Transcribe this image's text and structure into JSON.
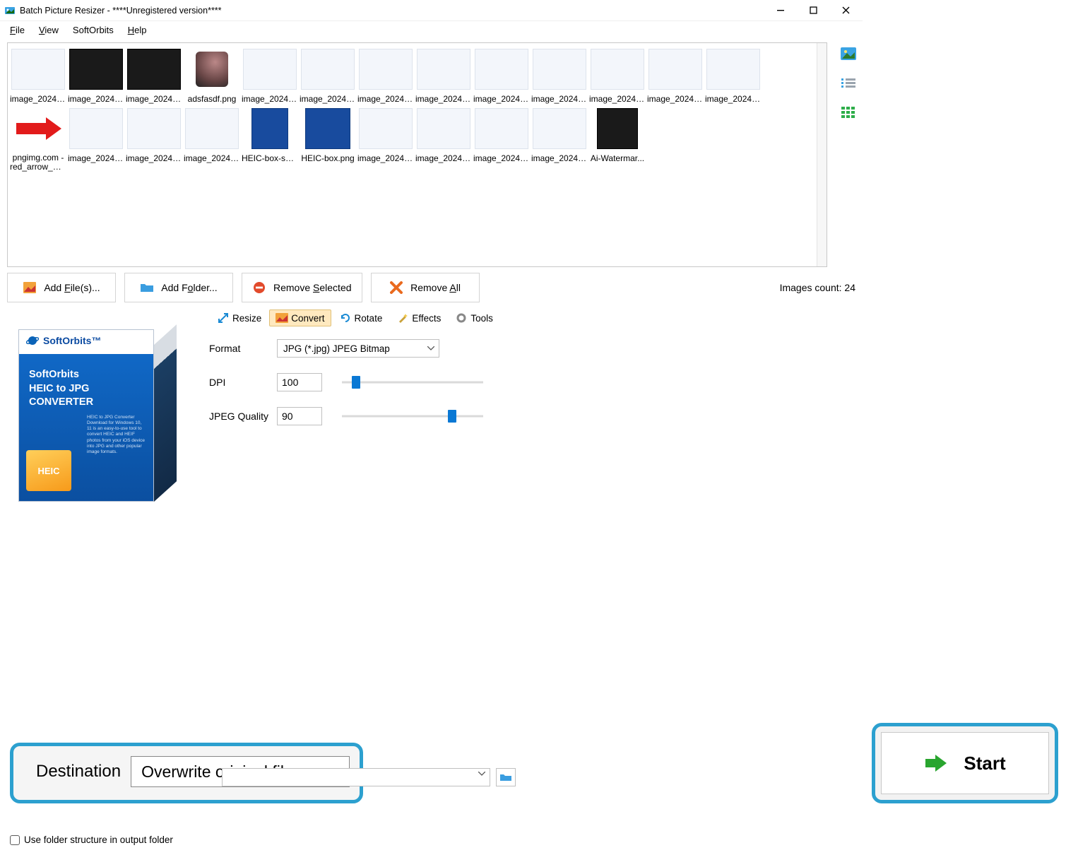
{
  "window": {
    "title": "Batch Picture Resizer - ****Unregistered version****"
  },
  "menu": {
    "file": "File",
    "view": "View",
    "softorbits": "SoftOrbits",
    "help": "Help"
  },
  "thumbnails": [
    {
      "label": "image_2024-..."
    },
    {
      "label": "image_2024-..."
    },
    {
      "label": "image_2024-..."
    },
    {
      "label": "adsfasdf.png"
    },
    {
      "label": "image_2024-..."
    },
    {
      "label": "image_2024-..."
    },
    {
      "label": "image_2024-..."
    },
    {
      "label": "image_2024-..."
    },
    {
      "label": "image_2024-..."
    },
    {
      "label": "image_2024-..."
    },
    {
      "label": "image_2024-..."
    },
    {
      "label": "image_2024-..."
    },
    {
      "label": "image_2024-..."
    },
    {
      "label": "pngimg.com - red_arrow_PN..."
    },
    {
      "label": "image_2024-..."
    },
    {
      "label": "image_2024-..."
    },
    {
      "label": "image_2024-..."
    },
    {
      "label": "HEIC-box-sm..."
    },
    {
      "label": "HEIC-box.png"
    },
    {
      "label": "image_2024-..."
    },
    {
      "label": "image_2024-..."
    },
    {
      "label": "image_2024-..."
    },
    {
      "label": "image_2024-..."
    },
    {
      "label": "Ai-Watermar..."
    }
  ],
  "actions": {
    "add_files": "Add File(s)...",
    "add_folder": "Add Folder...",
    "remove_selected": "Remove Selected",
    "remove_all": "Remove All"
  },
  "images_count_label": "Images count: 24",
  "tabs": {
    "resize": "Resize",
    "convert": "Convert",
    "rotate": "Rotate",
    "effects": "Effects",
    "tools": "Tools"
  },
  "promo": {
    "brand": "SoftOrbits™",
    "title1": "SoftOrbits",
    "title2": "HEIC to JPG CONVERTER",
    "badge": "HEIC",
    "desc": "HEIC to JPG Converter Download for Windows 10, 11 is an easy-to-use tool to convert HEIC and HEIF photos from your iOS device into JPG and other popular image formats."
  },
  "form": {
    "format_label": "Format",
    "format_value": "JPG (*.jpg) JPEG Bitmap",
    "dpi_label": "DPI",
    "dpi_value": "100",
    "quality_label": "JPEG Quality",
    "quality_value": "90"
  },
  "destination": {
    "label": "Destination",
    "value": "Overwrite original files"
  },
  "start_label": "Start",
  "folder_structure_label": "Use folder structure in output folder"
}
